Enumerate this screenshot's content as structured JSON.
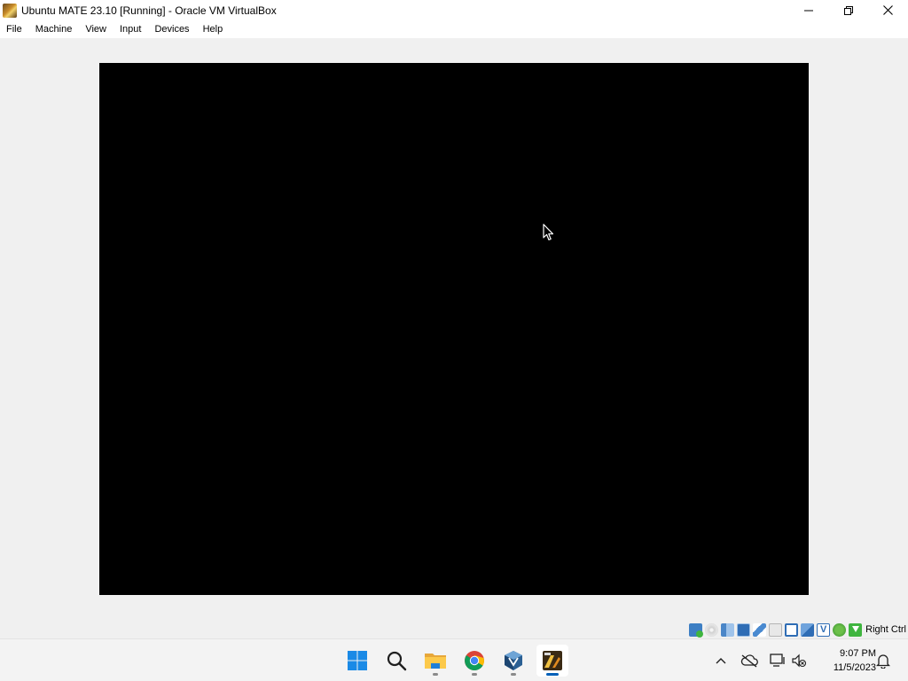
{
  "window": {
    "title": "Ubuntu MATE 23.10 [Running] - Oracle VM VirtualBox",
    "icon": "virtualbox-vm-icon"
  },
  "window_controls": [
    "minimize-icon",
    "maximize-icon",
    "close-icon"
  ],
  "menu": {
    "items": [
      "File",
      "Machine",
      "View",
      "Input",
      "Devices",
      "Help"
    ]
  },
  "vm_display": {
    "background": "#000000",
    "cursor": "mouse-pointer-icon"
  },
  "statusbar": {
    "icons": [
      "hard-disk-icon",
      "optical-drive-icon",
      "audio-icon",
      "network-icon",
      "usb-icon",
      "shared-folders-icon",
      "display-icon",
      "video-capture-icon",
      "virtualization-icon",
      "mouse-integration-icon",
      "keyboard-capture-icon"
    ],
    "host_key": "Right Ctrl"
  },
  "taskbar": {
    "apps": [
      "start-icon",
      "search-icon",
      "file-explorer-icon",
      "chrome-icon",
      "virtualbox-manager-icon",
      "vm-window-icon"
    ],
    "tray": {
      "icons": [
        "chevron-up-icon",
        "onedrive-offline-icon",
        "network-monitor-icon",
        "volume-muted-icon",
        "notification-bell-icon"
      ],
      "time": "9:07 PM",
      "date": "11/5/2023"
    }
  },
  "colors": {
    "accent": "#005fb8",
    "chrome": "#f0f0f0"
  }
}
